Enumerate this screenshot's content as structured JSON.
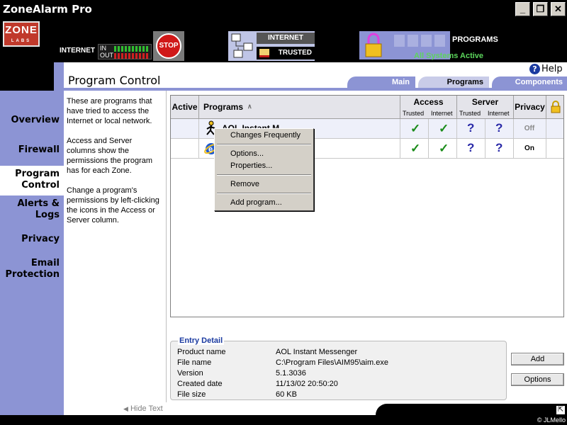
{
  "window": {
    "title": "ZoneAlarm Pro",
    "buttons": {
      "minimize": "_",
      "maximize": "❐",
      "close": "✕"
    }
  },
  "header": {
    "logo_main": "ZONE",
    "logo_sub": "LABS",
    "internet_label": "INTERNET",
    "in_label": "IN",
    "out_label": "OUT",
    "stop_label": "STOP",
    "zone_internet": "INTERNET",
    "zone_trusted": "TRUSTED",
    "programs_label": "PROGRAMS",
    "status": "All Systems Active",
    "colors": {
      "in_meter": "#2fbf2f",
      "out_meter": "#d02020",
      "status": "#5cd65c"
    }
  },
  "sidebar": {
    "items": [
      {
        "label": "Overview"
      },
      {
        "label": "Firewall"
      },
      {
        "label_line1": "Program",
        "label_line2": "Control"
      },
      {
        "label_line1": "Alerts &",
        "label_line2": "Logs"
      },
      {
        "label": "Privacy"
      },
      {
        "label_line1": "Email",
        "label_line2": "Protection"
      }
    ],
    "active": "Program Control"
  },
  "page": {
    "title": "Program Control",
    "help": "Help",
    "tabs": [
      {
        "label": "Main"
      },
      {
        "label": "Programs"
      },
      {
        "label": "Components"
      }
    ],
    "active_tab": "Programs",
    "description": [
      "These are programs that have tried to access the Internet or local network.",
      "Access and Server columns show the permissions the program has for each Zone.",
      "Change a program's permissions by left-clicking the icons in the Access or Server column."
    ],
    "hide_text": "Hide Text"
  },
  "table": {
    "headers": {
      "active": "Active",
      "programs": "Programs",
      "sort_indicator": "∧",
      "access": "Access",
      "server": "Server",
      "trusted": "Trusted",
      "internet": "Internet",
      "privacy": "Privacy"
    },
    "rows": [
      {
        "program_partial": "AOL Instant M...",
        "access_trusted": "✓",
        "access_internet": "✓",
        "server_trusted": "?",
        "server_internet": "?",
        "privacy": "Off",
        "icon": "aim-running-man-icon"
      },
      {
        "program_partial": "",
        "access_trusted": "✓",
        "access_internet": "✓",
        "server_trusted": "?",
        "server_internet": "?",
        "privacy": "On",
        "icon": "internet-explorer-icon"
      }
    ]
  },
  "context_menu": {
    "items": [
      {
        "label": "Changes Frequently"
      },
      {
        "label": "Options..."
      },
      {
        "label": "Properties..."
      },
      {
        "label": "Remove"
      },
      {
        "label": "Add program..."
      }
    ]
  },
  "entry_detail": {
    "legend": "Entry Detail",
    "fields": [
      {
        "label": "Product name",
        "value": "AOL Instant Messenger"
      },
      {
        "label": "File name",
        "value": "C:\\Program Files\\AIM95\\aim.exe"
      },
      {
        "label": "Version",
        "value": "5.1.3036"
      },
      {
        "label": "Created date",
        "value": "11/13/02 20:50:20"
      },
      {
        "label": "File size",
        "value": "60 KB"
      }
    ]
  },
  "buttons": {
    "add": "Add",
    "options": "Options"
  },
  "footer": {
    "copyright": "© JLMello"
  }
}
